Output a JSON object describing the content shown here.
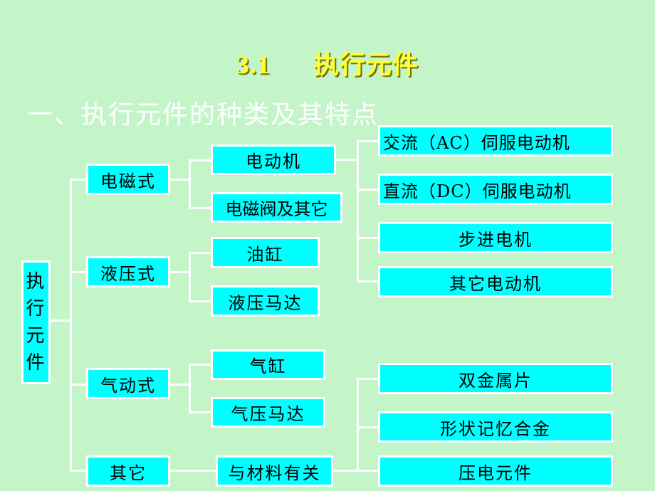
{
  "title": {
    "number": "3.1",
    "text": "执行元件"
  },
  "subtitle": "一、执行元件的种类及其特点",
  "root": {
    "label_chars": [
      "执",
      "行",
      "元",
      "件"
    ]
  },
  "categories": [
    {
      "label": "电磁式"
    },
    {
      "label": "液压式"
    },
    {
      "label": "气动式"
    },
    {
      "label": "其它"
    }
  ],
  "subtypes": {
    "electromagnetic": [
      "电动机",
      "电磁阀及其它"
    ],
    "hydraulic": [
      "油缸",
      "液压马达"
    ],
    "pneumatic": [
      "气缸",
      "气压马达"
    ],
    "other": [
      "与材料有关"
    ]
  },
  "motors": [
    "交流（AC）伺服电动机",
    "直流（DC）伺服电动机",
    "步进电机",
    "其它电动机"
  ],
  "materials": [
    "双金属片",
    "形状记忆合金",
    "压电元件"
  ],
  "colors": {
    "background": "#c3f5c8",
    "box": "#00ffff",
    "title": "#ffff33",
    "line": "#ffffff"
  }
}
